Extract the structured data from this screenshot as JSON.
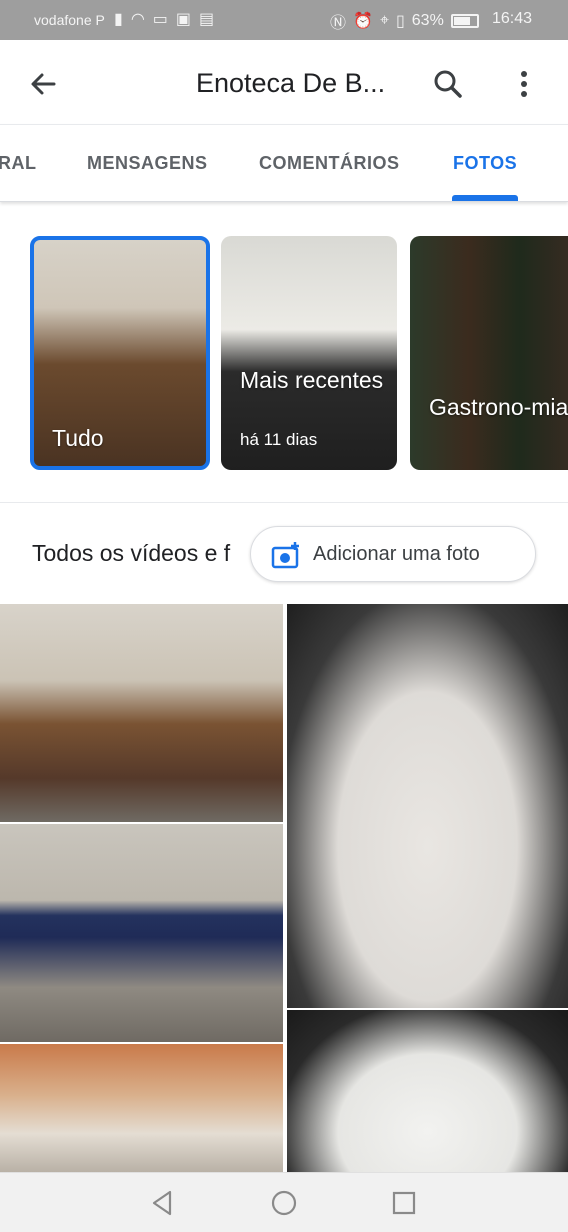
{
  "status_bar": {
    "carrier": "vodafone P",
    "battery": "63%",
    "time": "16:43"
  },
  "app_bar": {
    "title": "Enoteca De B..."
  },
  "tabs": [
    {
      "label": "RAL",
      "active": false
    },
    {
      "label": "MENSAGENS",
      "active": false
    },
    {
      "label": "COMENTÁRIOS",
      "active": false
    },
    {
      "label": "FOTOS",
      "active": true
    }
  ],
  "albums": [
    {
      "label": "Tudo",
      "sub": "",
      "selected": true
    },
    {
      "label": "Mais recentes",
      "sub": "há 11 dias",
      "selected": false
    },
    {
      "label": "Gastrono-mia",
      "sub": "",
      "selected": false
    }
  ],
  "section": {
    "title": "Todos os vídeos e f",
    "add_photo_label": "Adicionar uma foto"
  },
  "colors": {
    "accent": "#1a73e8",
    "tab_inactive": "#5f6368",
    "status_bar": "#9e9e9e"
  },
  "icons": {
    "back": "arrow-left-icon",
    "search": "search-icon",
    "more": "more-vert-icon",
    "add_photo": "add-photo-icon",
    "nav_back": "triangle-back-icon",
    "nav_home": "circle-home-icon",
    "nav_recents": "square-recents-icon"
  }
}
